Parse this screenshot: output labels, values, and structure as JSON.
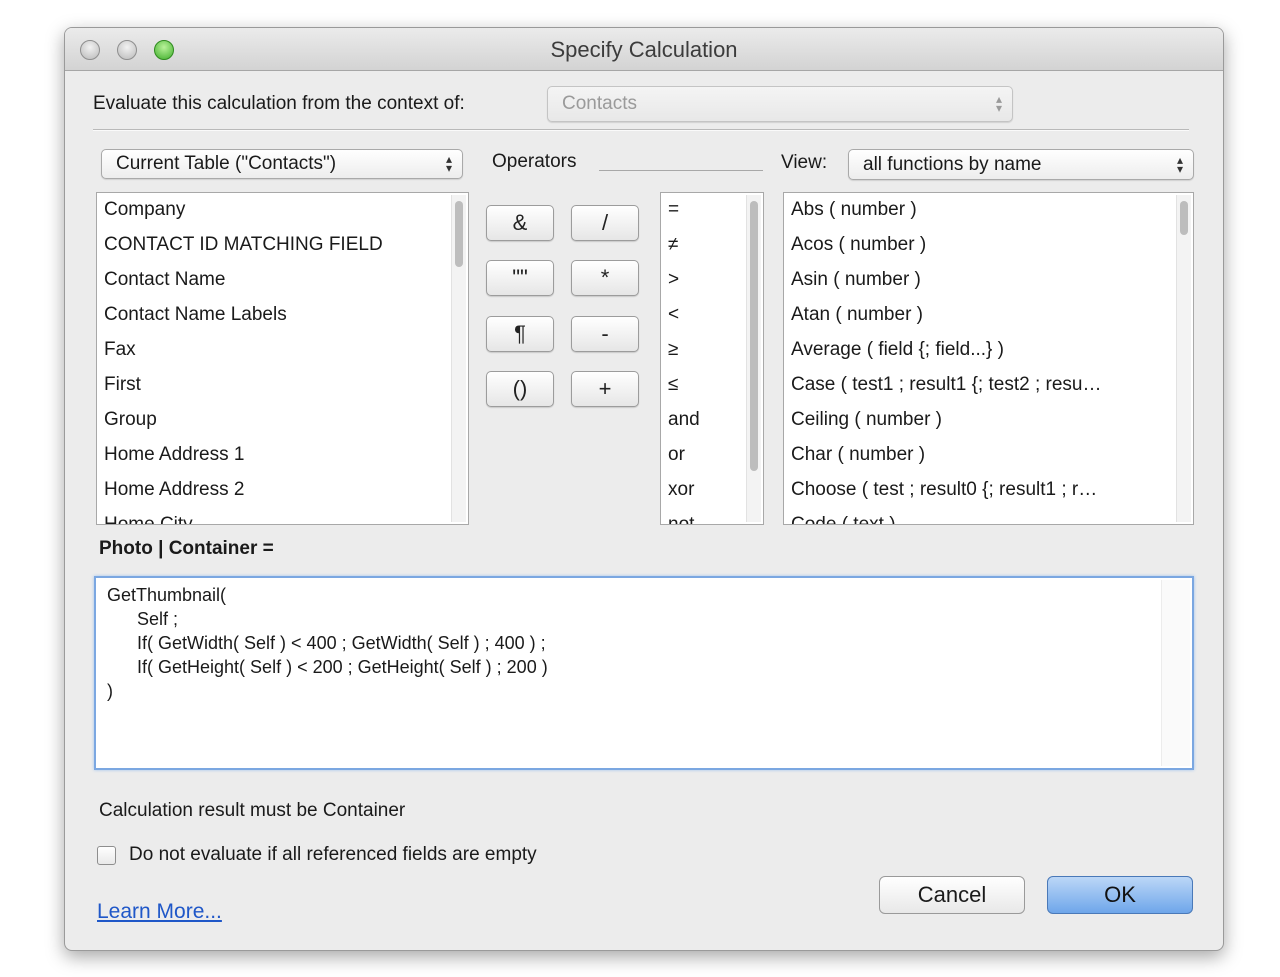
{
  "window": {
    "title": "Specify Calculation"
  },
  "context": {
    "label": "Evaluate this calculation from the context of:",
    "value": "Contacts"
  },
  "table_popup": {
    "value": "Current Table (\"Contacts\")"
  },
  "fields": [
    "Company",
    "CONTACT ID MATCHING FIELD",
    "Contact Name",
    "Contact Name Labels",
    "Fax",
    "First",
    "Group",
    "Home Address 1",
    "Home Address 2",
    "Home City"
  ],
  "operators": {
    "label": "Operators",
    "buttons": [
      "&",
      "/",
      "\"\"",
      "*",
      "¶",
      "-",
      "()",
      "+"
    ],
    "list": [
      "=",
      "≠",
      ">",
      "<",
      "≥",
      "≤",
      "and",
      "or",
      "xor",
      "not"
    ]
  },
  "view": {
    "label": "View:",
    "value": "all functions by name"
  },
  "functions": [
    "Abs ( number )",
    "Acos ( number )",
    "Asin ( number )",
    "Atan ( number )",
    "Average ( field {; field...} )",
    "Case ( test1 ; result1 {; test2 ; resu…",
    "Ceiling ( number )",
    "Char ( number )",
    "Choose ( test ; result0 {; result1 ; r…",
    "Code ( text )"
  ],
  "formula": {
    "label": "Photo | Container =",
    "text": "GetThumbnail(\n\tSelf ;\n\tIf( GetWidth( Self ) < 400 ; GetWidth( Self ) ; 400 ) ;\n\tIf( GetHeight( Self ) < 200 ; GetHeight( Self ) ; 200 )\n)"
  },
  "result_text": "Calculation result must be Container",
  "checkbox": {
    "label": "Do not evaluate if all referenced fields are empty",
    "checked": false
  },
  "buttons": {
    "cancel": "Cancel",
    "ok": "OK"
  },
  "learn_more": "Learn More...",
  "colors": {
    "accent": "#6ea6ea",
    "link": "#1f57c8",
    "focus_ring": "#7ba7e1"
  }
}
